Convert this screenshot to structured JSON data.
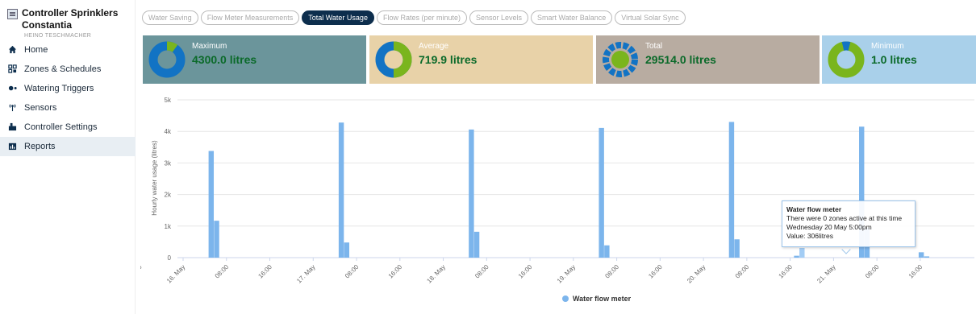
{
  "app": {
    "title": "Controller Sprinklers Constantia",
    "owner": "HEINO TESCHMACHER"
  },
  "sidebar": {
    "items": [
      {
        "label": "Home",
        "icon": "home-icon"
      },
      {
        "label": "Zones & Schedules",
        "icon": "grid-icon"
      },
      {
        "label": "Watering Triggers",
        "icon": "trigger-icon"
      },
      {
        "label": "Sensors",
        "icon": "antenna-icon"
      },
      {
        "label": "Controller Settings",
        "icon": "controller-icon"
      },
      {
        "label": "Reports",
        "icon": "chart-icon"
      }
    ],
    "active_index": 5
  },
  "tabs": [
    {
      "label": "Water Saving"
    },
    {
      "label": "Flow Meter Measurements"
    },
    {
      "label": "Total Water Usage"
    },
    {
      "label": "Flow Rates (per minute)"
    },
    {
      "label": "Sensor Levels"
    },
    {
      "label": "Smart Water Balance"
    },
    {
      "label": "Virtual Solar Sync"
    }
  ],
  "active_tab_index": 2,
  "cards": [
    {
      "label": "Maximum",
      "value": "4300.0 litres",
      "bg": "#6b959b",
      "donut": "ring-green-slice"
    },
    {
      "label": "Average",
      "value": "719.9 litres",
      "bg": "#e8d2a8",
      "donut": "ring-half"
    },
    {
      "label": "Total",
      "value": "29514.0 litres",
      "bg": "#b8aca1",
      "donut": "segmented"
    },
    {
      "label": "Minimum",
      "value": "1.0 litres",
      "bg": "#a9d0ea",
      "donut": "ring-mostly-green"
    }
  ],
  "colors": {
    "bar": "#7cb5ec",
    "bar_hover": "#a3cdf5",
    "donut_blue": "#1273c4",
    "donut_green": "#7ab51d",
    "value_green": "#0b6a2a"
  },
  "chart_data": {
    "type": "bar",
    "ylabel": "Hourly water usage (litres)",
    "ylim": [
      0,
      5000
    ],
    "y_ticks": [
      "0",
      "1k",
      "2k",
      "3k",
      "4k",
      "5k"
    ],
    "x_ticks": [
      "16:00",
      "16. May",
      "08:00",
      "16:00",
      "17. May",
      "08:00",
      "16:00",
      "18. May",
      "08:00",
      "16:00",
      "19. May",
      "08:00",
      "16:00",
      "20. May",
      "08:00",
      "16:00",
      "21. May",
      "08:00",
      "16:00"
    ],
    "x_unit": "hour index from 16 May 00:00",
    "series": [
      {
        "name": "Water flow meter",
        "points": [
          {
            "x": 5,
            "y": 3380
          },
          {
            "x": 6,
            "y": 1170
          },
          {
            "x": 29,
            "y": 4280
          },
          {
            "x": 30,
            "y": 480
          },
          {
            "x": 53,
            "y": 4060
          },
          {
            "x": 54,
            "y": 820
          },
          {
            "x": 77,
            "y": 4110
          },
          {
            "x": 78,
            "y": 390
          },
          {
            "x": 101,
            "y": 4300
          },
          {
            "x": 102,
            "y": 580
          },
          {
            "x": 113,
            "y": 60
          },
          {
            "x": 114,
            "y": 306
          },
          {
            "x": 125,
            "y": 4150
          },
          {
            "x": 126,
            "y": 950
          },
          {
            "x": 136,
            "y": 170
          },
          {
            "x": 137,
            "y": 40
          }
        ]
      }
    ],
    "highlight_x": 114,
    "grid": true,
    "legend": "bottom-center"
  },
  "tooltip": {
    "title": "Water flow meter",
    "line1": "There were 0 zones active at this time",
    "line2": "Wednesday 20 May 5:00pm",
    "line3": "Value: 306litres"
  },
  "legend": {
    "label": "Water flow meter"
  }
}
